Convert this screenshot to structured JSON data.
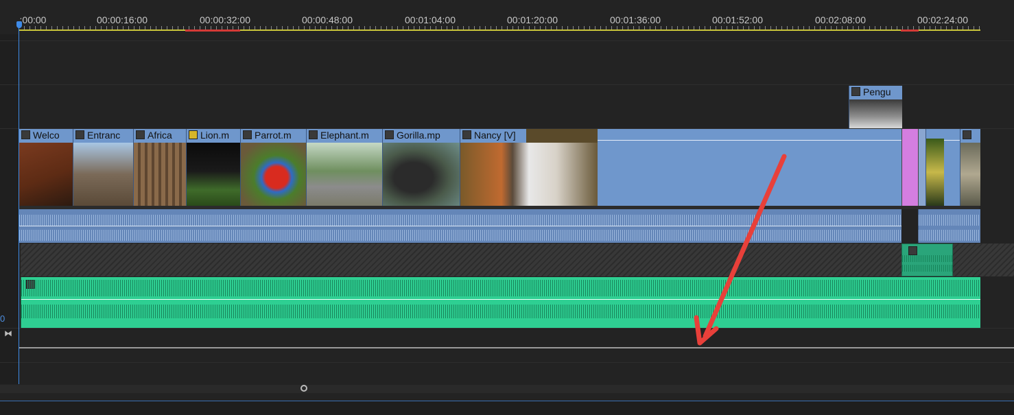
{
  "ruler": {
    "ticks": [
      "00:00",
      "00:00:16:00",
      "00:00:32:00",
      "00:00:48:00",
      "00:01:04:00",
      "00:01:20:00",
      "00:01:36:00",
      "00:01:52:00",
      "00:02:08:00",
      "00:02:24:00"
    ],
    "first_label": ":00:00"
  },
  "video_clips": [
    {
      "label": "Welco"
    },
    {
      "label": "Entranc"
    },
    {
      "label": "Africa"
    },
    {
      "label": "Lion.m"
    },
    {
      "label": "Parrot.m"
    },
    {
      "label": "Elephant.m"
    },
    {
      "label": "Gorilla.mp"
    },
    {
      "label": "Nancy [V]"
    }
  ],
  "overlay_clip": {
    "label": "Pengu"
  },
  "gutter": {
    "track_num": "0",
    "sync_icon": "⧓"
  },
  "colors": {
    "video": "#6f97cc",
    "audio": "#6486b8",
    "music": "#2ecf92",
    "annotation_arrow": "#e8403a"
  }
}
